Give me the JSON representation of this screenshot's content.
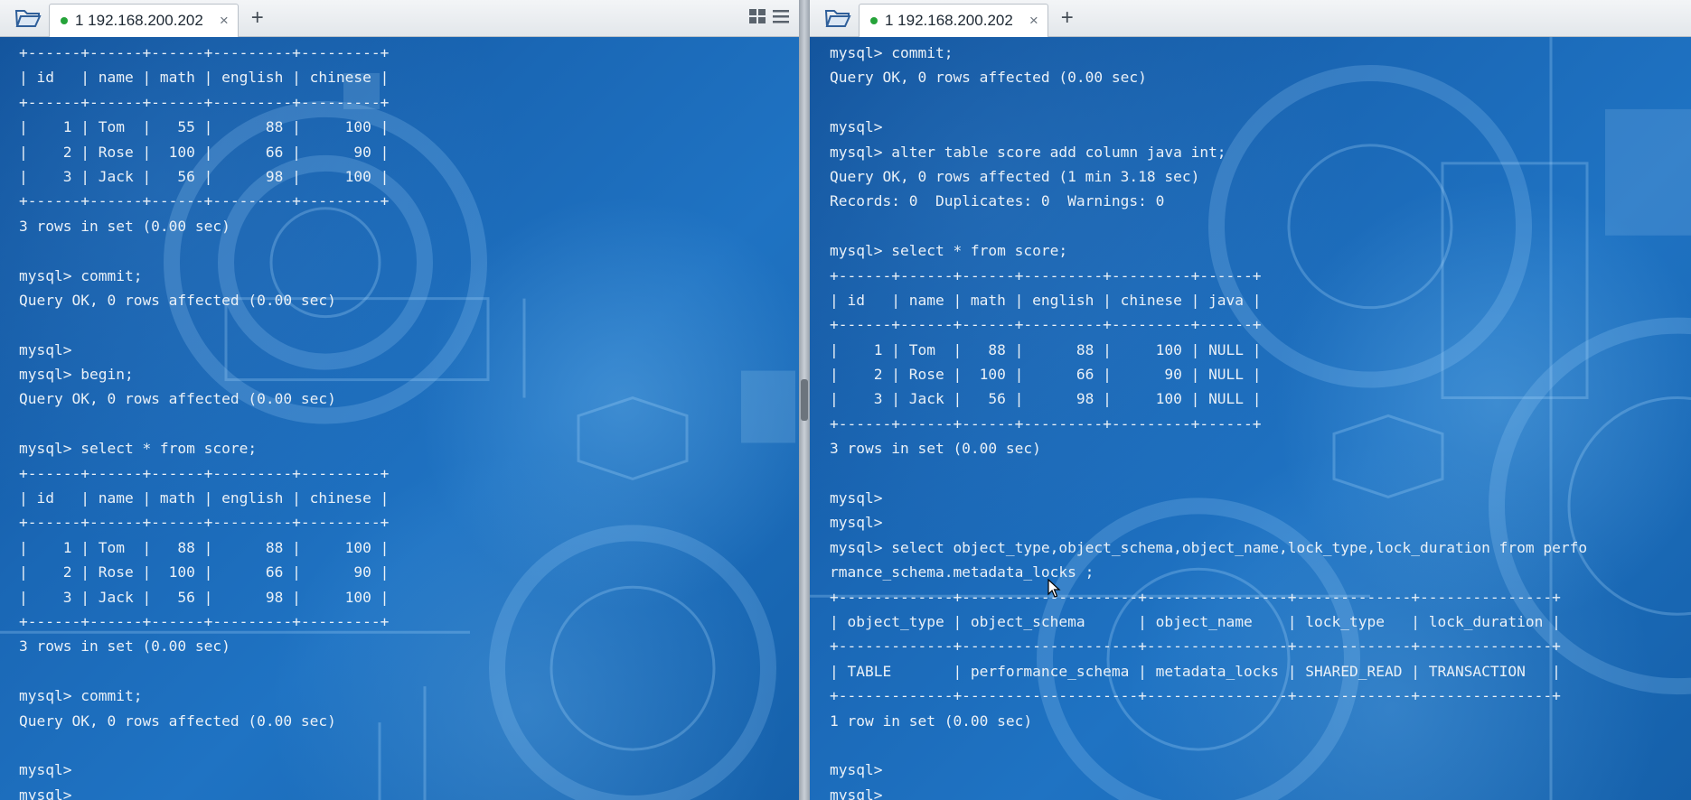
{
  "left_pane": {
    "tab_label": "1 192.168.200.202",
    "lines": [
      "+------+------+------+---------+---------+",
      "| id   | name | math | english | chinese |",
      "+------+------+------+---------+---------+",
      "|    1 | Tom  |   55 |      88 |     100 |",
      "|    2 | Rose |  100 |      66 |      90 |",
      "|    3 | Jack |   56 |      98 |     100 |",
      "+------+------+------+---------+---------+",
      "3 rows in set (0.00 sec)",
      "",
      "mysql> commit;",
      "Query OK, 0 rows affected (0.00 sec)",
      "",
      "mysql>",
      "mysql> begin;",
      "Query OK, 0 rows affected (0.00 sec)",
      "",
      "mysql> select * from score;",
      "+------+------+------+---------+---------+",
      "| id   | name | math | english | chinese |",
      "+------+------+------+---------+---------+",
      "|    1 | Tom  |   88 |      88 |     100 |",
      "|    2 | Rose |  100 |      66 |      90 |",
      "|    3 | Jack |   56 |      98 |     100 |",
      "+------+------+------+---------+---------+",
      "3 rows in set (0.00 sec)",
      "",
      "mysql> commit;",
      "Query OK, 0 rows affected (0.00 sec)",
      "",
      "mysql>",
      "mysql>"
    ]
  },
  "right_pane": {
    "tab_label": "1 192.168.200.202",
    "lines": [
      "mysql> commit;",
      "Query OK, 0 rows affected (0.00 sec)",
      "",
      "mysql>",
      "mysql> alter table score add column java int;",
      "Query OK, 0 rows affected (1 min 3.18 sec)",
      "Records: 0  Duplicates: 0  Warnings: 0",
      "",
      "mysql> select * from score;",
      "+------+------+------+---------+---------+------+",
      "| id   | name | math | english | chinese | java |",
      "+------+------+------+---------+---------+------+",
      "|    1 | Tom  |   88 |      88 |     100 | NULL |",
      "|    2 | Rose |  100 |      66 |      90 | NULL |",
      "|    3 | Jack |   56 |      98 |     100 | NULL |",
      "+------+------+------+---------+---------+------+",
      "3 rows in set (0.00 sec)",
      "",
      "mysql>",
      "mysql>",
      "mysql> select object_type,object_schema,object_name,lock_type,lock_duration from perfo",
      "rmance_schema.metadata_locks ;",
      "+-------------+--------------------+----------------+-------------+---------------+",
      "| object_type | object_schema      | object_name    | lock_type   | lock_duration |",
      "+-------------+--------------------+----------------+-------------+---------------+",
      "| TABLE       | performance_schema | metadata_locks | SHARED_READ | TRANSACTION   |",
      "+-------------+--------------------+----------------+-------------+---------------+",
      "1 row in set (0.00 sec)",
      "",
      "mysql>",
      "mysql>"
    ]
  },
  "icons": {
    "folder": "folder-open-icon",
    "status_dot": "connected-dot-icon",
    "close": "close-icon",
    "add": "add-tab-icon",
    "grid": "grid-layout-icon",
    "menu": "menu-icon",
    "cursor": "mouse-pointer-icon"
  },
  "tab_close_glyph": "×",
  "add_glyph": "+",
  "colors": {
    "terminal_text": "#e9f0f7",
    "status_dot": "#25a339",
    "terminal_bg": "#1a67b5"
  }
}
